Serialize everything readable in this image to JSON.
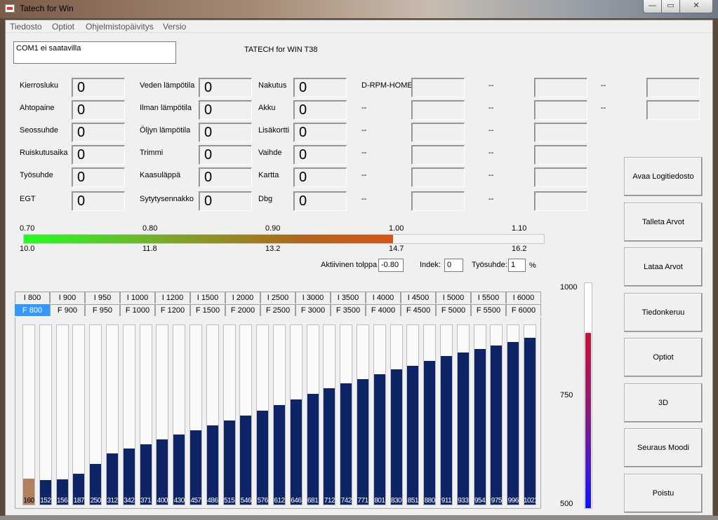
{
  "window": {
    "title": "Tatech for Win",
    "min": "—",
    "max": "▭",
    "close": "✕"
  },
  "menu": [
    "Tiedosto",
    "Optiot",
    "Ohjelmistopäivitys",
    "Versio"
  ],
  "status": {
    "text": "COM1 ei saatavilla"
  },
  "heading": "TATECH for WIN T38",
  "gauges_col1": [
    {
      "label": "Kierrosluku",
      "value": "0"
    },
    {
      "label": "Ahtopaine",
      "value": "0"
    },
    {
      "label": "Seossuhde",
      "value": "0"
    },
    {
      "label": "Ruiskutusaika",
      "value": "0"
    },
    {
      "label": "Työsuhde",
      "value": "0"
    },
    {
      "label": "EGT",
      "value": "0"
    }
  ],
  "gauges_col2": [
    {
      "label": "Veden lämpötila",
      "value": "0"
    },
    {
      "label": "Ilman lämpötila",
      "value": "0"
    },
    {
      "label": "Öljyn lämpötila",
      "value": "0"
    },
    {
      "label": "Trimmi",
      "value": "0"
    },
    {
      "label": "Kaasuläppä",
      "value": "0"
    },
    {
      "label": "Sytytysennakko",
      "value": "0"
    }
  ],
  "gauges_col3": [
    {
      "label": "Nakutus",
      "value": "0"
    },
    {
      "label": "Akku",
      "value": "0"
    },
    {
      "label": "Lisäkortti",
      "value": "0"
    },
    {
      "label": "Vaihde",
      "value": "0"
    },
    {
      "label": "Kartta",
      "value": "0"
    },
    {
      "label": "Dbg",
      "value": "0"
    }
  ],
  "gauges_col4_labels": [
    "D-RPM-HOME",
    "--",
    "--",
    "--",
    "--",
    "--"
  ],
  "gauges_col5_labels": [
    "--",
    "--",
    "--",
    "--",
    "--",
    "--"
  ],
  "gauges_col6_labels": [
    "--",
    "--"
  ],
  "lambda_scale": {
    "top_ticks": [
      "0.70",
      "0.80",
      "0.90",
      "1.00",
      "1.10"
    ],
    "bottom_ticks": [
      "10.0",
      "11.8",
      "13.2",
      "14.7",
      "16.2"
    ],
    "fill_fraction": 0.71
  },
  "controls": {
    "active_column_label": "Aktiivinen tolppa",
    "active_column_value": "-0.80",
    "index_label": "Indek:",
    "index_value": "0",
    "duty_label": "Työsuhde:",
    "duty_value": "1",
    "duty_unit": "%"
  },
  "tabs_row1": [
    "I 800",
    "I 900",
    "I 950",
    "I 1000",
    "I 1200",
    "I 1500",
    "I 2000",
    "I 2500",
    "I 3000",
    "I 3500",
    "I 4000",
    "I 4500",
    "I 5000",
    "I 5500",
    "I 6000"
  ],
  "tabs_row2": [
    "F 800",
    "F 900",
    "F 950",
    "F 1000",
    "F 1200",
    "F 1500",
    "F 2000",
    "F 2500",
    "F 3000",
    "F 3500",
    "F 4000",
    "F 4500",
    "F 5000",
    "F 5500",
    "F 6000"
  ],
  "active_tab": "F 800",
  "bar_values": [
    160,
    152,
    156,
    187,
    250,
    312,
    342,
    371,
    400,
    430,
    457,
    486,
    515,
    546,
    576,
    612,
    646,
    681,
    712,
    742,
    771,
    801,
    830,
    851,
    880,
    911,
    933,
    954,
    975,
    996,
    1021
  ],
  "bar_labels": [
    "160",
    "152",
    "156",
    "187",
    "250",
    "312",
    "342",
    "371",
    "400",
    "430",
    "457",
    "486",
    "515",
    "546",
    "576",
    "612",
    "646",
    "681",
    "712",
    "742",
    "771",
    "801",
    "830",
    "851",
    "880",
    "911",
    "933",
    "954",
    "975",
    "996",
    "1021"
  ],
  "vertical_scale": {
    "ticks": [
      "1000",
      "750",
      "500"
    ],
    "fill_fraction": 0.78
  },
  "buttons": [
    "Avaa Logitiedosto",
    "Talleta Arvot",
    "Lataa Arvot",
    "Tiedonkeruu",
    "Optiot",
    "3D",
    "Seuraus Moodi",
    "Poistu"
  ],
  "colors": {
    "bar_fill": "#0d2466",
    "first_bar_fill": "#b08060",
    "active_tab": "#3399ff"
  }
}
